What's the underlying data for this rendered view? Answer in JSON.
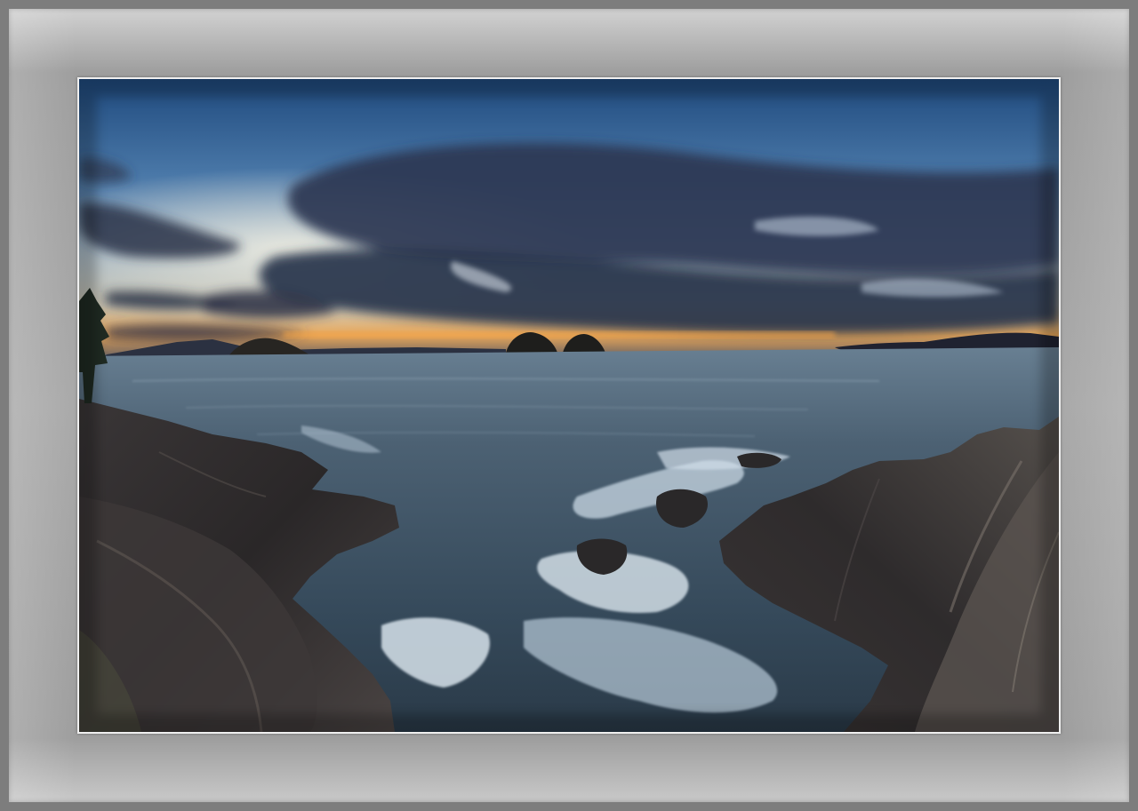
{
  "image": {
    "subject": "framed-seascape-photograph",
    "colors": {
      "frame_outer": "#7d7d7d",
      "mat": "#a9a9a9",
      "photo_border": "#f0f0f0",
      "sky_top": "#2e5585",
      "cloud_dark": "#2a3650",
      "horizon_glow": "#f0a24a",
      "sea": "#3c5062",
      "rock": "#2b2a2c",
      "surf": "#d9e4ec"
    }
  }
}
